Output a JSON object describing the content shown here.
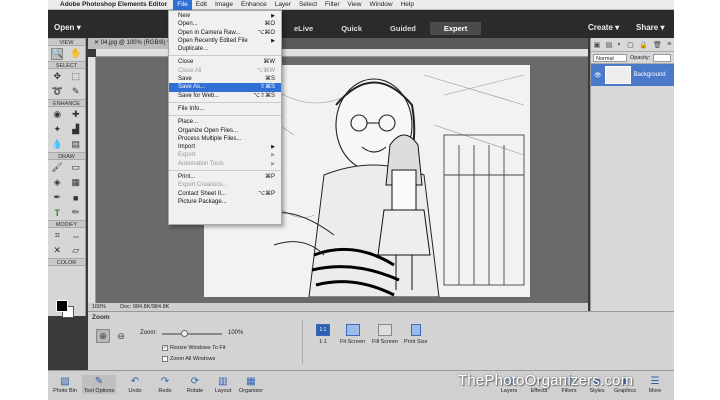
{
  "menubar": {
    "apple": "",
    "app_name": "Adobe Photoshop Elements Editor",
    "items": [
      "File",
      "Edit",
      "Image",
      "Enhance",
      "Layer",
      "Select",
      "Filter",
      "View",
      "Window",
      "Help"
    ],
    "active": "File"
  },
  "topbar": {
    "open_label": "Open",
    "modes": [
      "eLive",
      "Quick",
      "Guided",
      "Expert"
    ],
    "active_mode": "Expert",
    "create_label": "Create",
    "share_label": "Share"
  },
  "toolbox": {
    "sections": [
      "VIEW",
      "SELECT",
      "ENHANCE",
      "DRAW",
      "MODIFY",
      "COLOR"
    ],
    "colors": {
      "foreground": "#000000",
      "background": "#ffffff"
    }
  },
  "document": {
    "tab_label": "04.jpg @ 100% (RGB/8) *",
    "status_zoom": "100%",
    "status_doc": "Doc: 984.8K/984.8K"
  },
  "layers": {
    "blend_mode": "Normal",
    "opacity_label": "Opacity:",
    "layer_name": "Background"
  },
  "tool_options": {
    "title": "Zoom",
    "zoom_label": "Zoom:",
    "zoom_value": "100%",
    "zoom_slider_fraction": 0.36,
    "resize_windows": "Resize Windows To Fit",
    "resize_checked": true,
    "zoom_all": "Zoom All Windows",
    "zoom_all_checked": false,
    "buttons": [
      "1:1",
      "Fit Screen",
      "Fill Screen",
      "Print Size"
    ],
    "one_to_one_icon": "1:1"
  },
  "bottombar": {
    "items": [
      "Photo Bin",
      "Tool Options",
      "Undo",
      "Redo",
      "Rotate",
      "Layout",
      "Organizer",
      "Layers",
      "Effects",
      "Filters",
      "Styles",
      "Graphics",
      "More"
    ]
  },
  "file_menu": {
    "new": "New",
    "open": "Open...",
    "open_sc": "⌘O",
    "open_raw": "Open in Camera Raw...",
    "open_raw_sc": "⌥⌘O",
    "open_recent": "Open Recently Edited File",
    "duplicate": "Duplicate...",
    "close": "Close",
    "close_sc": "⌘W",
    "close_all": "Close All",
    "close_all_sc": "⌥⌘W",
    "save": "Save",
    "save_sc": "⌘S",
    "save_as": "Save As...",
    "save_as_sc": "⇧⌘S",
    "save_web": "Save for Web...",
    "save_web_sc": "⌥⇧⌘S",
    "file_info": "File Info...",
    "place": "Place...",
    "organize": "Organize Open Files...",
    "process": "Process Multiple Files...",
    "import": "Import",
    "export": "Export",
    "automation": "Automation Tools",
    "print": "Print...",
    "print_sc": "⌘P",
    "export_creations": "Export Creations...",
    "contact_sheet": "Contact Sheet II...",
    "contact_sheet_sc": "⌥⌘P",
    "picture_package": "Picture Package..."
  },
  "watermark": "ThePhotoOrganizers.com"
}
